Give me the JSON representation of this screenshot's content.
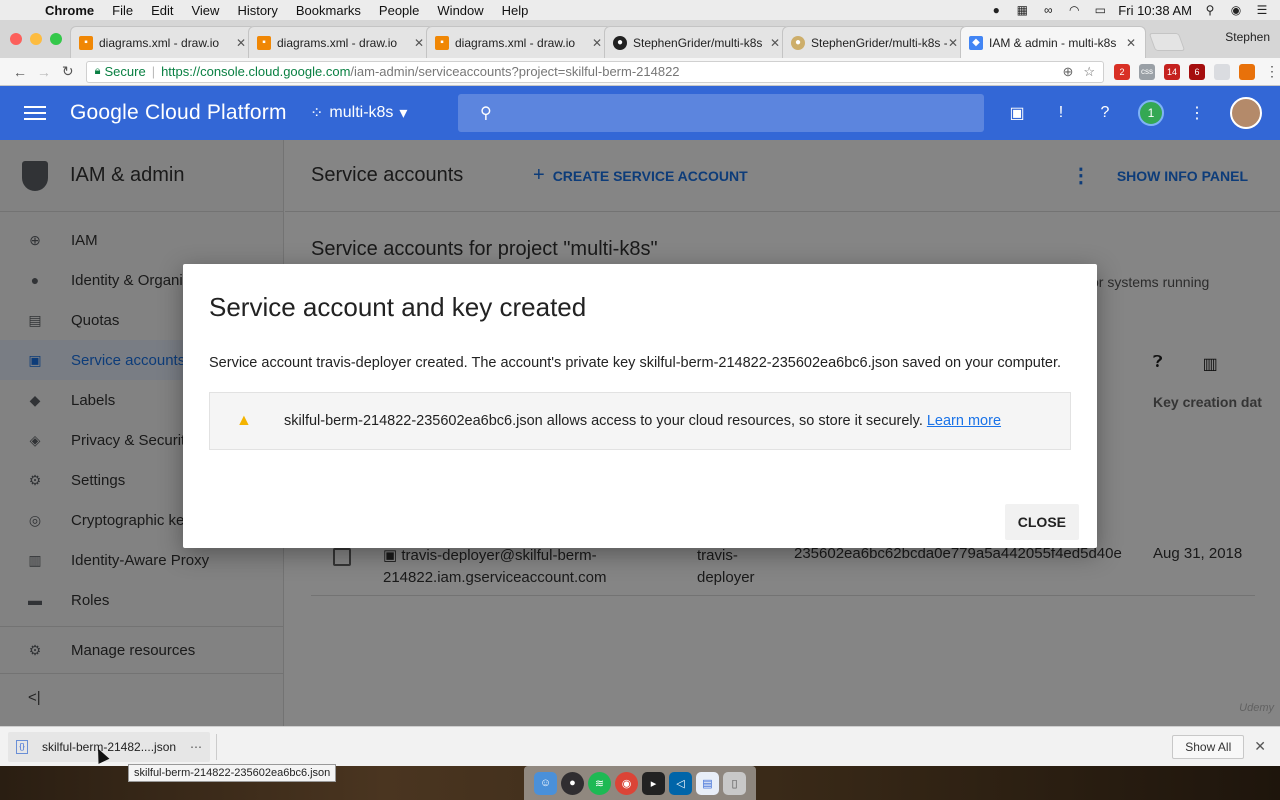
{
  "menubar": {
    "app": "Chrome",
    "items": [
      "File",
      "Edit",
      "View",
      "History",
      "Bookmarks",
      "People",
      "Window",
      "Help"
    ],
    "clock": "Fri 10:38 AM"
  },
  "tabs": [
    {
      "label": "diagrams.xml - draw.io",
      "icon": "drawio-icon"
    },
    {
      "label": "diagrams.xml - draw.io",
      "icon": "drawio-icon"
    },
    {
      "label": "diagrams.xml - draw.io",
      "icon": "drawio-icon"
    },
    {
      "label": "StephenGrider/multi-k8s",
      "icon": "github-icon"
    },
    {
      "label": "StephenGrider/multi-k8s -",
      "icon": "travis-icon"
    },
    {
      "label": "IAM & admin - multi-k8s",
      "icon": "gcp-icon"
    }
  ],
  "profile": "Stephen",
  "address": {
    "secure_label": "Secure",
    "url_host": "https://console.cloud.google.com",
    "url_path": "/iam-admin/serviceaccounts?project=skilful-berm-214822"
  },
  "extensions": {
    "ext1": "2",
    "ext2": "css",
    "ext3": "14",
    "ext4": "6"
  },
  "header": {
    "brand": "Google Cloud Platform",
    "project": "multi-k8s",
    "notification_count": "1"
  },
  "sidebar": {
    "title": "IAM & admin",
    "items": [
      {
        "label": "IAM",
        "icon": "person-add-icon"
      },
      {
        "label": "Identity & Organization",
        "icon": "account-circle-icon"
      },
      {
        "label": "Quotas",
        "icon": "quotas-icon"
      },
      {
        "label": "Service accounts",
        "icon": "service-account-icon"
      },
      {
        "label": "Labels",
        "icon": "label-icon"
      },
      {
        "label": "Privacy & Security",
        "icon": "privacy-shield-icon"
      },
      {
        "label": "Settings",
        "icon": "gear-icon"
      },
      {
        "label": "Cryptographic keys",
        "icon": "key-shield-icon"
      },
      {
        "label": "Identity-Aware Proxy",
        "icon": "proxy-icon"
      },
      {
        "label": "Roles",
        "icon": "roles-icon"
      },
      {
        "label": "Manage resources",
        "icon": "manage-resources-icon"
      }
    ],
    "collapse": "<|"
  },
  "main": {
    "title": "Service accounts",
    "create_button": "CREATE SERVICE ACCOUNT",
    "info_panel": "SHOW INFO PANEL",
    "section_title": "Service accounts for project \"multi-k8s\"",
    "section_desc": "or systems running",
    "column_key_date": "Key creation dat",
    "row": {
      "email": "travis-deployer@skilful-berm-214822.iam.gserviceaccount.com",
      "name": "travis-deployer",
      "key_id": "235602ea6bc62bcda0e779a5a442055f4ed5d40e",
      "date": "Aug 31, 2018"
    },
    "watermark": "Udemy"
  },
  "dialog": {
    "title": "Service account and key created",
    "text": "Service account travis-deployer created. The account's private key skilful-berm-214822-235602ea6bc6.json saved on your computer.",
    "warning": "skilful-berm-214822-235602ea6bc6.json allows access to your cloud resources, so store it securely.",
    "learn_more": "Learn more",
    "close": "CLOSE"
  },
  "downloads": {
    "file_label": "skilful-berm-21482....json",
    "tooltip": "skilful-berm-214822-235602ea6bc6.json",
    "show_all": "Show All"
  },
  "colors": {
    "gcp_blue": "#3367d6",
    "link_blue": "#1a73e8",
    "warning_yellow": "#f4b400"
  }
}
